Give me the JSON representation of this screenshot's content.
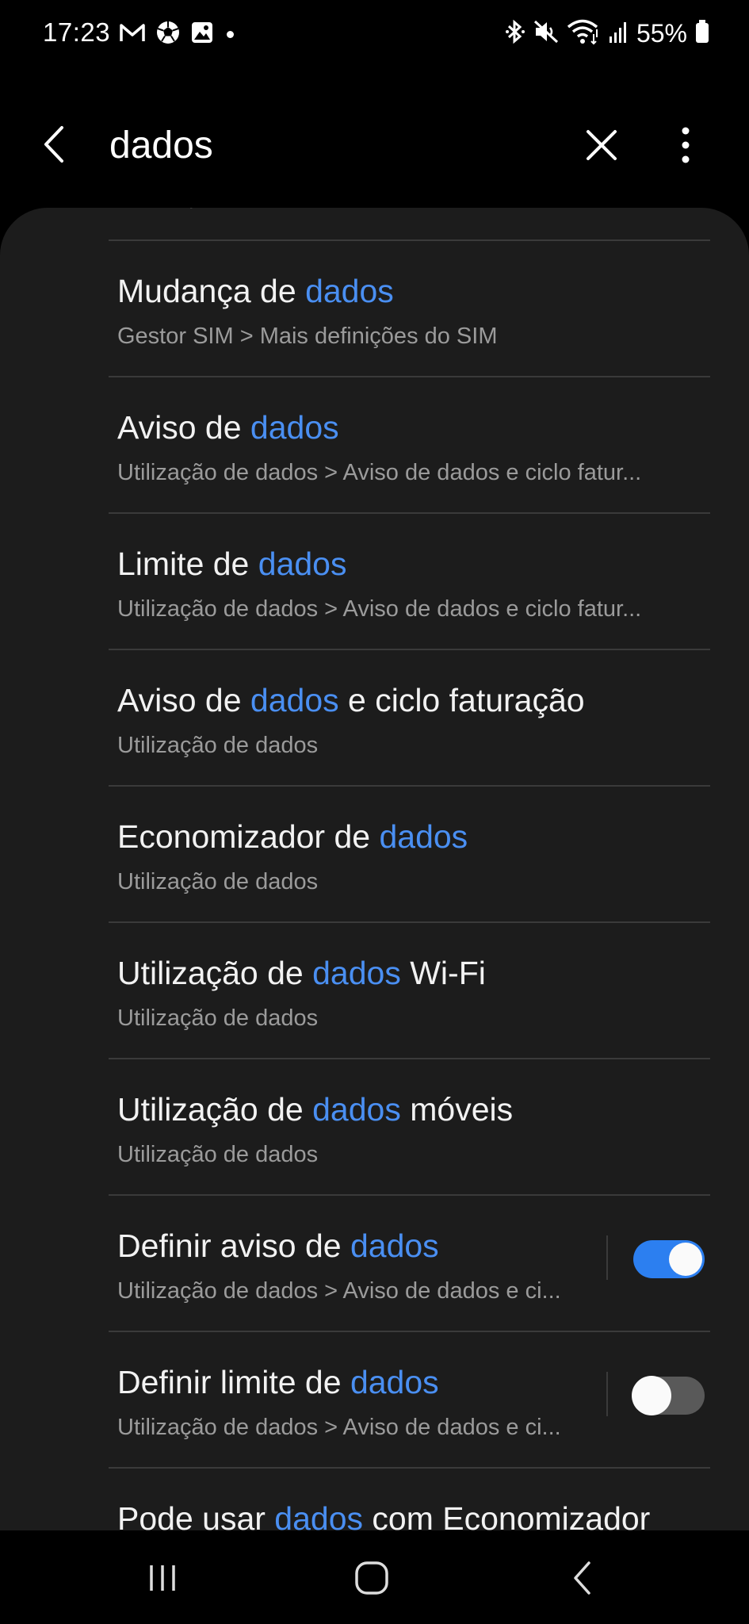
{
  "status_bar": {
    "time": "17:23",
    "battery": "55%",
    "left_icons": [
      "gmail-icon",
      "soccer-ball-icon",
      "gallery-icon",
      "notification-dot"
    ],
    "right_icons": [
      "bluetooth-icon",
      "mute-icon",
      "wifi-icon",
      "signal-icon",
      "battery-icon"
    ]
  },
  "search": {
    "query": "dados"
  },
  "results": [
    {
      "before": "Mudança de ",
      "highlight": "dados",
      "after": "",
      "summary": "Gestor SIM > Mais definições do SIM"
    },
    {
      "before": "Aviso de ",
      "highlight": "dados",
      "after": "",
      "summary": "Utilização de dados > Aviso de dados e ciclo fatur..."
    },
    {
      "before": "Limite de ",
      "highlight": "dados",
      "after": "",
      "summary": "Utilização de dados > Aviso de dados e ciclo fatur..."
    },
    {
      "before": "Aviso de ",
      "highlight": "dados",
      "after": " e ciclo faturação",
      "summary": "Utilização de dados"
    },
    {
      "before": "Economizador de ",
      "highlight": "dados",
      "after": "",
      "summary": "Utilização de dados"
    },
    {
      "before": "Utilização de ",
      "highlight": "dados",
      "after": " Wi-Fi",
      "summary": "Utilização de dados"
    },
    {
      "before": "Utilização de ",
      "highlight": "dados",
      "after": " móveis",
      "summary": "Utilização de dados"
    },
    {
      "before": "Definir aviso de ",
      "highlight": "dados",
      "after": "",
      "summary": "Utilização de dados > Aviso de dados e ci...",
      "toggle": true
    },
    {
      "before": "Definir limite de ",
      "highlight": "dados",
      "after": "",
      "summary": "Utilização de dados > Aviso de dados e ci...",
      "toggle": false
    },
    {
      "before": "Pode usar ",
      "highlight": "dados",
      "after": " com Economizador",
      "summary": ""
    }
  ],
  "colors": {
    "highlight": "#4a8ff2",
    "toggle_on": "#2c7ff0",
    "toggle_off": "#595959",
    "card_background": "#1c1c1c"
  },
  "nav_bar": {
    "buttons": [
      "recent-apps",
      "home",
      "back"
    ]
  }
}
